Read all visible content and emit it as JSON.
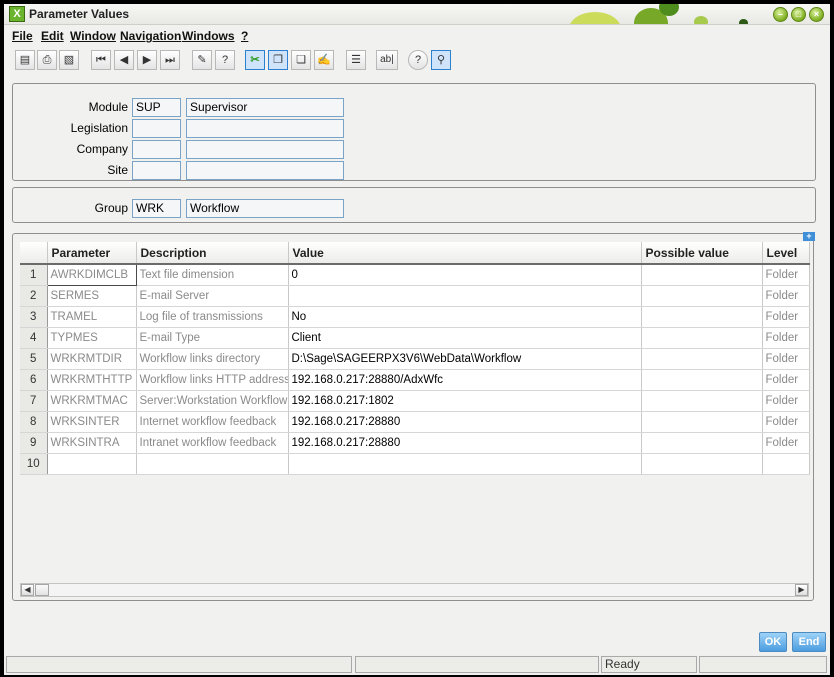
{
  "window": {
    "title": "Parameter Values",
    "logo_glyph": "X",
    "controls": [
      "–",
      "□",
      "×"
    ]
  },
  "menu": [
    "File",
    "Edit",
    "Window",
    "Navigation",
    "Windows",
    "?"
  ],
  "toolbar": [
    {
      "name": "new-icon",
      "glyph": "▤"
    },
    {
      "name": "print-icon",
      "glyph": "⎙"
    },
    {
      "name": "print-preview-icon",
      "glyph": "▧"
    },
    {
      "name": "first-record-icon",
      "glyph": "⏮"
    },
    {
      "name": "previous-record-icon",
      "glyph": "◀"
    },
    {
      "name": "next-record-icon",
      "glyph": "▶"
    },
    {
      "name": "last-record-icon",
      "glyph": "⏭"
    },
    {
      "name": "attach-icon",
      "glyph": "✎"
    },
    {
      "name": "help-icon",
      "glyph": "?"
    },
    {
      "name": "cut-icon",
      "glyph": "✂"
    },
    {
      "name": "copy-icon",
      "glyph": "❐"
    },
    {
      "name": "paste-icon",
      "glyph": "❏"
    },
    {
      "name": "edit-icon",
      "glyph": "✍"
    },
    {
      "name": "list-icon",
      "glyph": "☰"
    },
    {
      "name": "text-field-icon",
      "glyph": "ab|"
    },
    {
      "name": "about-icon",
      "glyph": "?"
    },
    {
      "name": "search-icon",
      "glyph": "⚲"
    }
  ],
  "header": {
    "module_label": "Module",
    "module_code": "SUP",
    "module_name": "Supervisor",
    "legislation_label": "Legislation",
    "company_label": "Company",
    "site_label": "Site"
  },
  "group": {
    "label": "Group",
    "code": "WRK",
    "name": "Workflow"
  },
  "grid": {
    "columns": [
      "Parameter",
      "Description",
      "Value",
      "Possible value",
      "Level"
    ],
    "rows": [
      {
        "num": "1",
        "param": "AWRKDIMCLB",
        "desc": "Text file dimension",
        "value": "0",
        "possible": "",
        "level": "Folder"
      },
      {
        "num": "2",
        "param": "SERMES",
        "desc": "E-mail Server",
        "value": "",
        "possible": "",
        "level": "Folder"
      },
      {
        "num": "3",
        "param": "TRAMEL",
        "desc": "Log file of transmissions",
        "value": "No",
        "possible": "",
        "level": "Folder"
      },
      {
        "num": "4",
        "param": "TYPMES",
        "desc": "E-mail Type",
        "value": "Client",
        "possible": "",
        "level": "Folder"
      },
      {
        "num": "5",
        "param": "WRKRMTDIR",
        "desc": "Workflow links directory",
        "value": "D:\\Sage\\SAGEERPX3V6\\WebData\\Workflow",
        "possible": "",
        "level": "Folder"
      },
      {
        "num": "6",
        "param": "WRKRMTHTTP",
        "desc": "Workflow links HTTP address",
        "value": "192.168.0.217:28880/AdxWfc",
        "possible": "",
        "level": "Folder"
      },
      {
        "num": "7",
        "param": "WRKRMTMAC",
        "desc": "Server:Workstation Workflow li",
        "value": "192.168.0.217:1802",
        "possible": "",
        "level": "Folder"
      },
      {
        "num": "8",
        "param": "WRKSINTER",
        "desc": "Internet workflow feedback",
        "value": "192.168.0.217:28880",
        "possible": "",
        "level": "Folder"
      },
      {
        "num": "9",
        "param": "WRKSINTRA",
        "desc": "Intranet workflow feedback",
        "value": "192.168.0.217:28880",
        "possible": "",
        "level": "Folder"
      },
      {
        "num": "10",
        "param": "",
        "desc": "",
        "value": "",
        "possible": "",
        "level": ""
      }
    ],
    "expand_glyph": "+",
    "scroll_left_glyph": "◀",
    "scroll_right_glyph": "▶"
  },
  "buttons": {
    "ok": "OK",
    "end": "End"
  },
  "status": {
    "text": "Ready"
  },
  "colors": {
    "accent_green": "#7fae20",
    "field_border": "#7aa3c8",
    "button_blue": "#4c9de0"
  }
}
